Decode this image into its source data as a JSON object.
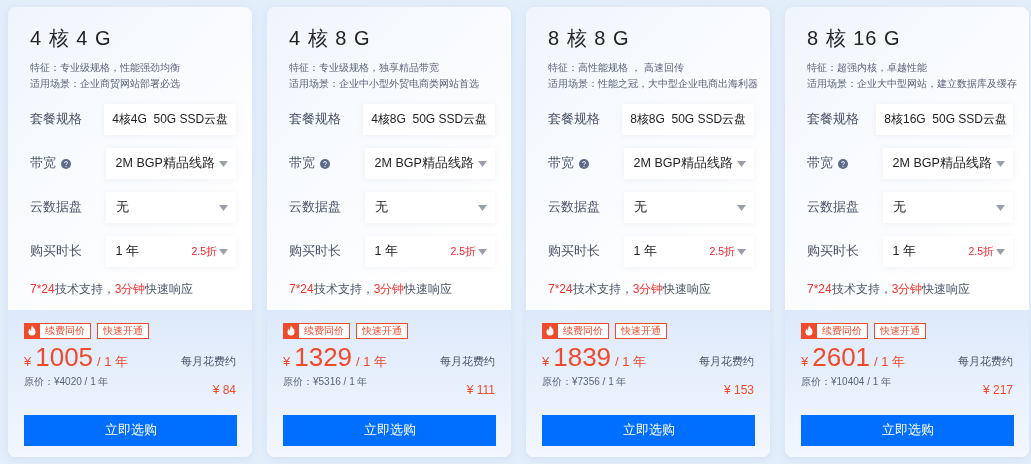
{
  "plans": [
    {
      "title": "4 核 4 G",
      "features": "特征：专业级规格，性能强劲均衡",
      "scenario": "适用场景：企业商贸网站部署必选",
      "options": [
        {
          "kind": "text",
          "label": "套餐规格",
          "value": "4核4G  50G SSD云盘",
          "help": false
        },
        {
          "kind": "select",
          "label": "带宽",
          "value": "2M BGP精品线路",
          "help": true
        },
        {
          "kind": "select",
          "label": "云数据盘",
          "value": "无",
          "help": false
        },
        {
          "kind": "select",
          "label": "购买时长",
          "value": "1 年",
          "discount": "2.5折",
          "help": false
        }
      ],
      "support": [
        {
          "text": "7*24",
          "highlight": true
        },
        {
          "text": "技术支持，",
          "highlight": false
        },
        {
          "text": "3分钟",
          "highlight": true
        },
        {
          "text": "快速响应",
          "highlight": false
        }
      ],
      "tags": [
        {
          "kind": "hot",
          "label": "续费同价"
        },
        {
          "kind": "plain",
          "label": "快速开通"
        }
      ],
      "currency": "¥",
      "price": "1005",
      "period": "/ 1 年",
      "original": "原价：¥4020 / 1 年",
      "monthly_label": "每月花费约",
      "monthly": "¥ 84",
      "button": "立即选购"
    },
    {
      "title": "4 核 8 G",
      "features": "特征：专业级规格，独享精品带宽",
      "scenario": "适用场景：企业中小型外贸电商类网站首选",
      "options": [
        {
          "kind": "text",
          "label": "套餐规格",
          "value": "4核8G  50G SSD云盘",
          "help": false
        },
        {
          "kind": "select",
          "label": "带宽",
          "value": "2M BGP精品线路",
          "help": true
        },
        {
          "kind": "select",
          "label": "云数据盘",
          "value": "无",
          "help": false
        },
        {
          "kind": "select",
          "label": "购买时长",
          "value": "1 年",
          "discount": "2.5折",
          "help": false
        }
      ],
      "support": [
        {
          "text": "7*24",
          "highlight": true
        },
        {
          "text": "技术支持，",
          "highlight": false
        },
        {
          "text": "3分钟",
          "highlight": true
        },
        {
          "text": "快速响应",
          "highlight": false
        }
      ],
      "tags": [
        {
          "kind": "hot",
          "label": "续费同价"
        },
        {
          "kind": "plain",
          "label": "快速开通"
        }
      ],
      "currency": "¥",
      "price": "1329",
      "period": "/ 1 年",
      "original": "原价：¥5316 / 1 年",
      "monthly_label": "每月花费约",
      "monthly": "¥ 111",
      "button": "立即选购"
    },
    {
      "title": "8 核 8 G",
      "features": "特征：高性能规格 ， 高速回传",
      "scenario": "适用场景：性能之冠，大中型企业电商出海利器",
      "options": [
        {
          "kind": "text",
          "label": "套餐规格",
          "value": "8核8G  50G SSD云盘",
          "help": false
        },
        {
          "kind": "select",
          "label": "带宽",
          "value": "2M BGP精品线路",
          "help": true
        },
        {
          "kind": "select",
          "label": "云数据盘",
          "value": "无",
          "help": false
        },
        {
          "kind": "select",
          "label": "购买时长",
          "value": "1 年",
          "discount": "2.5折",
          "help": false
        }
      ],
      "support": [
        {
          "text": "7*24",
          "highlight": true
        },
        {
          "text": "技术支持，",
          "highlight": false
        },
        {
          "text": "3分钟",
          "highlight": true
        },
        {
          "text": "快速响应",
          "highlight": false
        }
      ],
      "tags": [
        {
          "kind": "hot",
          "label": "续费同价"
        },
        {
          "kind": "plain",
          "label": "快速开通"
        }
      ],
      "currency": "¥",
      "price": "1839",
      "period": "/ 1 年",
      "original": "原价：¥7356 / 1 年",
      "monthly_label": "每月花费约",
      "monthly": "¥ 153",
      "button": "立即选购"
    },
    {
      "title": "8 核 16 G",
      "features": "特征：超强内核，卓越性能",
      "scenario": "适用场景：企业大中型网站，建立数据库及缓存",
      "options": [
        {
          "kind": "text",
          "label": "套餐规格",
          "value": "8核16G  50G SSD云盘",
          "help": false
        },
        {
          "kind": "select",
          "label": "带宽",
          "value": "2M BGP精品线路",
          "help": true
        },
        {
          "kind": "select",
          "label": "云数据盘",
          "value": "无",
          "help": false
        },
        {
          "kind": "select",
          "label": "购买时长",
          "value": "1 年",
          "discount": "2.5折",
          "help": false
        }
      ],
      "support": [
        {
          "text": "7*24",
          "highlight": true
        },
        {
          "text": "技术支持，",
          "highlight": false
        },
        {
          "text": "3分钟",
          "highlight": true
        },
        {
          "text": "快速响应",
          "highlight": false
        }
      ],
      "tags": [
        {
          "kind": "hot",
          "label": "续费同价"
        },
        {
          "kind": "plain",
          "label": "快速开通"
        }
      ],
      "currency": "¥",
      "price": "2601",
      "period": "/ 1 年",
      "original": "原价：¥10404 / 1 年",
      "monthly_label": "每月花费约",
      "monthly": "¥ 217",
      "button": "立即选购"
    }
  ]
}
